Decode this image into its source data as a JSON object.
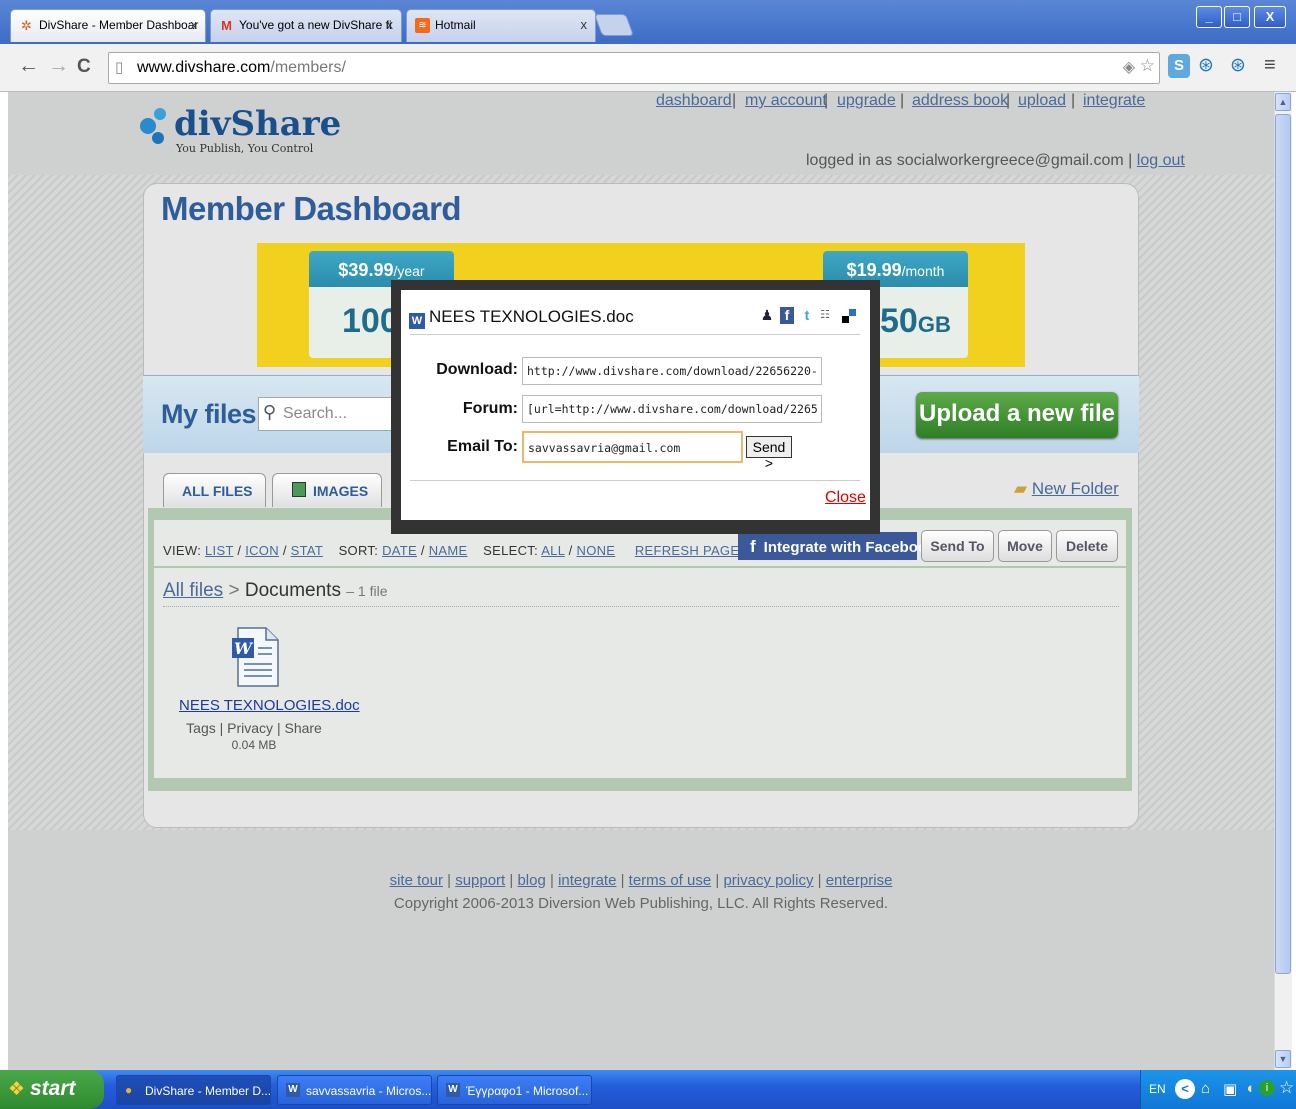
{
  "browser": {
    "tabs": [
      {
        "label": "DivShare - Member Dashboar",
        "icon": "divshare-favicon"
      },
      {
        "label": "You've got a new DivShare fi",
        "icon": "gmail-icon"
      },
      {
        "label": "Hotmail",
        "icon": "hotmail-icon"
      }
    ],
    "tab_close": "x",
    "url_host": "www.divshare.com",
    "url_path": "/members/",
    "window_buttons": [
      "_",
      "□",
      "X"
    ]
  },
  "site": {
    "logo_text": "divShare",
    "logo_tagline": "You Publish, You Control",
    "top_links": [
      "dashboard",
      "my account",
      "upgrade",
      "address book",
      "upload",
      "integrate"
    ],
    "logged_in_prefix": "logged in as socialworkergreece@gmail.com |",
    "logout": "log out",
    "dashboard_title": "Member Dashboard",
    "promo": {
      "left_price": "$39.99",
      "left_period": "/year",
      "left_big": "100",
      "right_price": "$19.99",
      "right_period": "/month",
      "right_big": "50",
      "right_unit": "GB"
    },
    "myfiles_title": "My files",
    "search_placeholder": "Search...",
    "upload_button": "Upload a new file",
    "file_tabs": [
      "ALL FILES",
      "IMAGES"
    ],
    "new_folder": "New Folder",
    "view_label": "VIEW:",
    "view_options": [
      "LIST",
      "ICON",
      "STAT"
    ],
    "sort_label": "SORT:",
    "sort_options": [
      "DATE",
      "NAME"
    ],
    "select_label": "SELECT:",
    "select_options": [
      "ALL",
      "NONE"
    ],
    "refresh": "REFRESH PAGE",
    "facebook_button": "Integrate with Facebook",
    "action_buttons": [
      "Send To",
      "Move",
      "Delete"
    ],
    "breadcrumb_root": "All files",
    "breadcrumb_sep": ">",
    "breadcrumb_current": "Documents",
    "breadcrumb_count": "– 1 file",
    "file": {
      "name": "NEES TEXNOLOGIES.doc",
      "actions": [
        "Tags",
        "Privacy",
        "Share"
      ],
      "size": "0.04 MB"
    },
    "footer_links": [
      "site tour",
      "support",
      "blog",
      "integrate",
      "terms of use",
      "privacy policy",
      "enterprise"
    ],
    "copyright": "Copyright 2006-2013 Diversion Web Publishing, LLC. All Rights Reserved."
  },
  "popup": {
    "title": "NEES TEXNOLOGIES.doc",
    "share_icons": [
      "myspace-icon",
      "facebook-icon",
      "twitter-icon",
      "digg-icon",
      "delicious-icon"
    ],
    "download_label": "Download:",
    "download_value": "http://www.divshare.com/download/22656220-",
    "forum_label": "Forum:",
    "forum_value": "[url=http://www.divshare.com/download/2265",
    "email_label": "Email To:",
    "email_value": "savvassavria@gmail.com",
    "send_button": "Send >",
    "close": "Close"
  },
  "taskbar": {
    "start": "start",
    "tasks": [
      "DivShare - Member D...",
      "savvassavria - Micros...",
      "Έγγραφο1 - Microsof..."
    ],
    "language": "EN"
  },
  "colors": {
    "brand_blue": "#2f5d9a",
    "upload_green": "#3f8f33",
    "facebook": "#3b5998",
    "banner_yellow": "#f1d11e",
    "close_red": "#dd0000"
  }
}
